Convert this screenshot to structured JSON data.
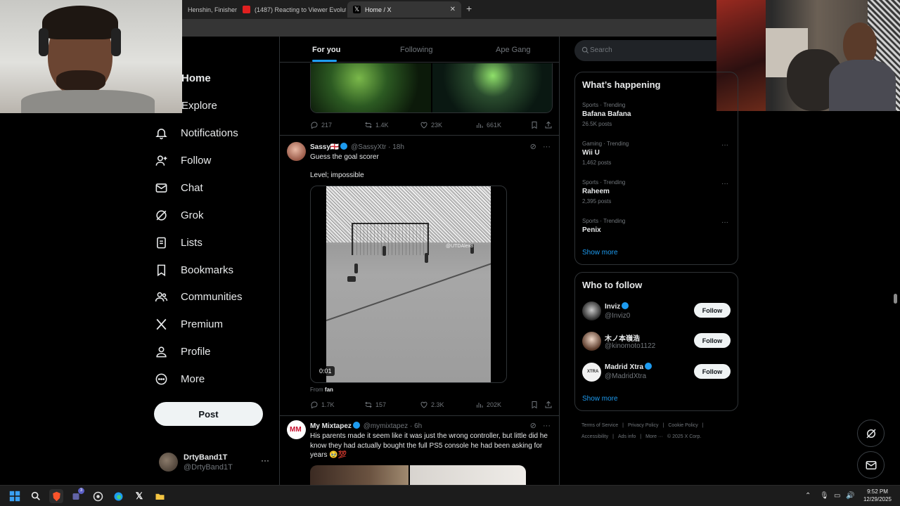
{
  "browser": {
    "tabs": [
      {
        "label": "Henshin, Finisher"
      },
      {
        "label": "(1487) Reacting to Viewer Evolutions"
      },
      {
        "label": "Home / X"
      }
    ],
    "new_tab_icon": "plus-icon",
    "close_icon": "close-icon"
  },
  "sidebar": {
    "items": [
      {
        "label": "Home",
        "icon": "home-icon"
      },
      {
        "label": "Explore",
        "icon": "search-icon"
      },
      {
        "label": "Notifications",
        "icon": "bell-icon"
      },
      {
        "label": "Follow",
        "icon": "person-plus-icon"
      },
      {
        "label": "Chat",
        "icon": "mail-icon"
      },
      {
        "label": "Grok",
        "icon": "grok-icon"
      },
      {
        "label": "Lists",
        "icon": "list-icon"
      },
      {
        "label": "Bookmarks",
        "icon": "bookmark-icon"
      },
      {
        "label": "Communities",
        "icon": "people-icon"
      },
      {
        "label": "Premium",
        "icon": "x-logo-icon"
      },
      {
        "label": "Profile",
        "icon": "person-icon"
      },
      {
        "label": "More",
        "icon": "more-circle-icon"
      }
    ],
    "post_label": "Post",
    "account": {
      "name": "DrtyBand1T",
      "handle": "@DrtyBand1T",
      "more": "···"
    }
  },
  "timeline": {
    "tabs": [
      {
        "label": "For you",
        "selected": true
      },
      {
        "label": "Following",
        "selected": false
      },
      {
        "label": "Ape Gang",
        "selected": false
      }
    ],
    "top_actions": {
      "replies": "217",
      "reposts": "1.4K",
      "likes": "23K",
      "views": "661K"
    },
    "tweet1": {
      "name": "Sassy🏴󠁧󠁢󠁥󠁮󠁧󠁿",
      "handle": "@SassyXtr",
      "time": "18h",
      "text_line1": "Guess the goal scorer",
      "text_line2": "Level; impossible",
      "video_time": "0:01",
      "watermark": "@UTDAlex8",
      "from_prefix": "From",
      "from_source": "fan",
      "actions": {
        "replies": "1.7K",
        "reposts": "157",
        "likes": "2.3K",
        "views": "202K"
      }
    },
    "tweet2": {
      "name": "My Mixtapez",
      "handle": "@mymixtapez",
      "time": "6h",
      "text": "His parents made it seem like it was just the wrong controller, but little did he know they had actually bought the full PS5 console he had been asking for years 🥹💯"
    }
  },
  "right": {
    "search_placeholder": "Search",
    "happening_title": "What’s happening",
    "trends": [
      {
        "category": "Sports · Trending",
        "name": "Bafana Bafana",
        "posts": "26.5K posts"
      },
      {
        "category": "Gaming · Trending",
        "name": "Wii U",
        "posts": "1,462 posts"
      },
      {
        "category": "Sports · Trending",
        "name": "Raheem",
        "posts": "2,395 posts"
      },
      {
        "category": "Sports · Trending",
        "name": "Penix",
        "posts": ""
      }
    ],
    "trend_more": "···",
    "show_more": "Show more",
    "who_to_follow_title": "Who to follow",
    "who_to_follow": [
      {
        "name": "Inviz",
        "handle": "@Inviz0",
        "button": "Follow"
      },
      {
        "name": "木ノ本嶺浩",
        "handle": "@kinomoto1122",
        "button": "Follow"
      },
      {
        "name": "Madrid Xtra",
        "handle": "@MadridXtra",
        "button": "Follow"
      }
    ],
    "footer": [
      "Terms of Service",
      "|",
      "Privacy Policy",
      "|",
      "Cookie Policy",
      "|",
      "Accessibility",
      "|",
      "Ads info",
      "|",
      "More ···",
      "© 2025 X Corp."
    ]
  },
  "taskbar": {
    "time": "9:52 PM",
    "date": "12/29/2025",
    "badge": "3"
  },
  "colors": {
    "accent": "#1d9bf0",
    "background": "#000000",
    "border": "#2f3336",
    "muted": "#71767b"
  }
}
